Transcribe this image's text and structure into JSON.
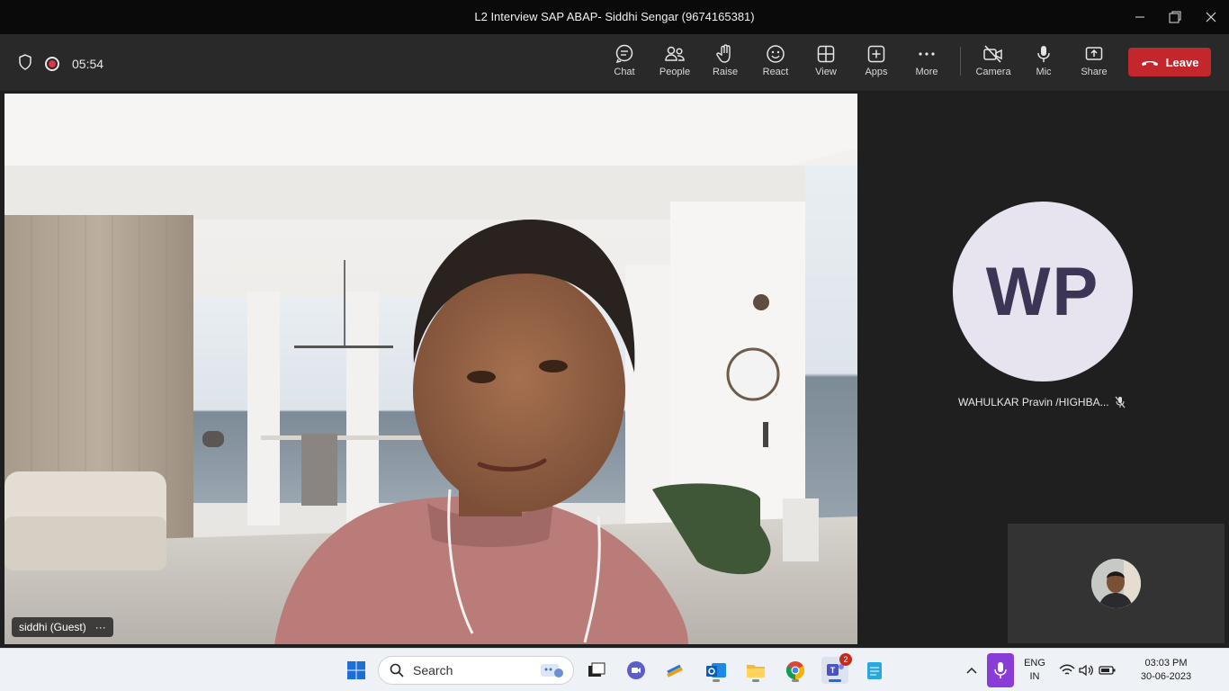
{
  "window": {
    "title": "L2 Interview SAP ABAP- Siddhi Sengar (9674165381)",
    "minimize_icon": "minimize-icon",
    "maximize_icon": "restore-icon",
    "close_icon": "close-icon"
  },
  "meeting": {
    "timer": "05:54",
    "shield_icon": "shield-icon",
    "recording_icon": "record-icon"
  },
  "toolbar": {
    "buttons": [
      {
        "label": "Chat",
        "icon": "chat-icon"
      },
      {
        "label": "People",
        "icon": "people-icon"
      },
      {
        "label": "Raise",
        "icon": "hand-icon"
      },
      {
        "label": "React",
        "icon": "smile-icon"
      },
      {
        "label": "View",
        "icon": "grid-icon"
      },
      {
        "label": "Apps",
        "icon": "plus-icon"
      },
      {
        "label": "More",
        "icon": "more-icon"
      },
      {
        "label": "Camera",
        "icon": "camera-off-icon"
      },
      {
        "label": "Mic",
        "icon": "mic-icon"
      },
      {
        "label": "Share",
        "icon": "share-icon"
      }
    ],
    "leave_label": "Leave",
    "leave_color": "#c4262e"
  },
  "main_video": {
    "participant_name": "siddhi (Guest)",
    "more_label": "···"
  },
  "side_participant": {
    "initials": "WP",
    "name": "WAHULKAR Pravin /HIGHBA...",
    "mute_icon": "mic-off-icon"
  },
  "taskbar": {
    "search_placeholder": "Search",
    "language_line1": "ENG",
    "language_line2": "IN",
    "time": "03:03 PM",
    "date": "30-06-2023",
    "teams_badge": "2"
  }
}
